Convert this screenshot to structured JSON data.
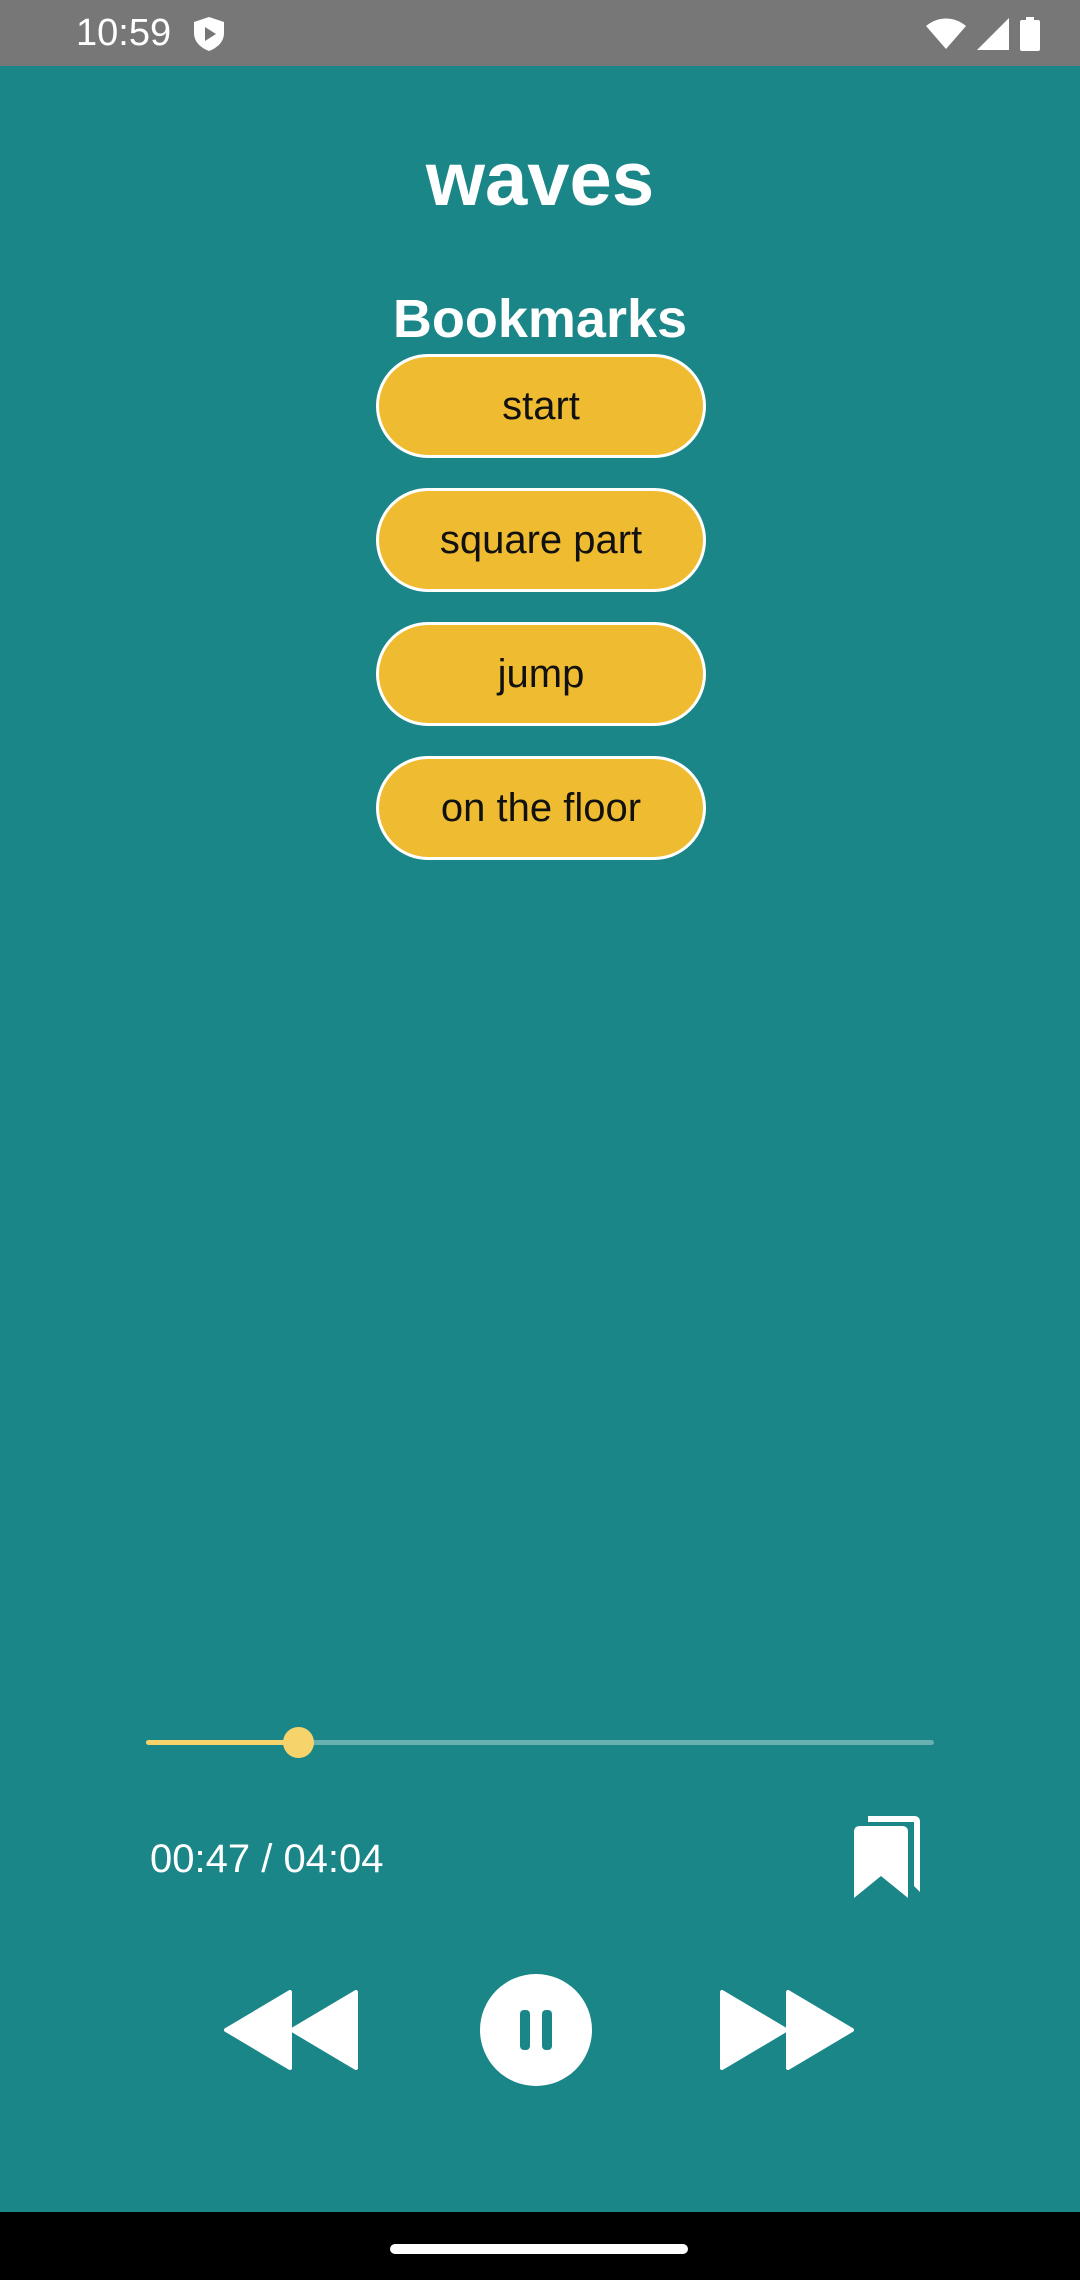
{
  "status_bar": {
    "time": "10:59",
    "icons": [
      "shield-play-icon",
      "wifi-icon",
      "cell-signal-icon",
      "battery-icon"
    ]
  },
  "app": {
    "title": "waves"
  },
  "bookmarks": {
    "heading": "Bookmarks",
    "items": [
      {
        "label": "start"
      },
      {
        "label": "square part"
      },
      {
        "label": "jump"
      },
      {
        "label": "on the floor"
      }
    ]
  },
  "player": {
    "elapsed": "00:47",
    "duration": "04:04",
    "time_text": "00:47 / 04:04",
    "progress_fraction": 0.193,
    "state": "playing",
    "controls": [
      "rewind-icon",
      "pause-icon",
      "fast-forward-icon",
      "bookmark-add-icon"
    ]
  },
  "colors": {
    "background": "#1a8688",
    "accent": "#efbb31",
    "seek_accent": "#f7d36b",
    "status_bar": "#777777",
    "text": "#ffffff"
  }
}
